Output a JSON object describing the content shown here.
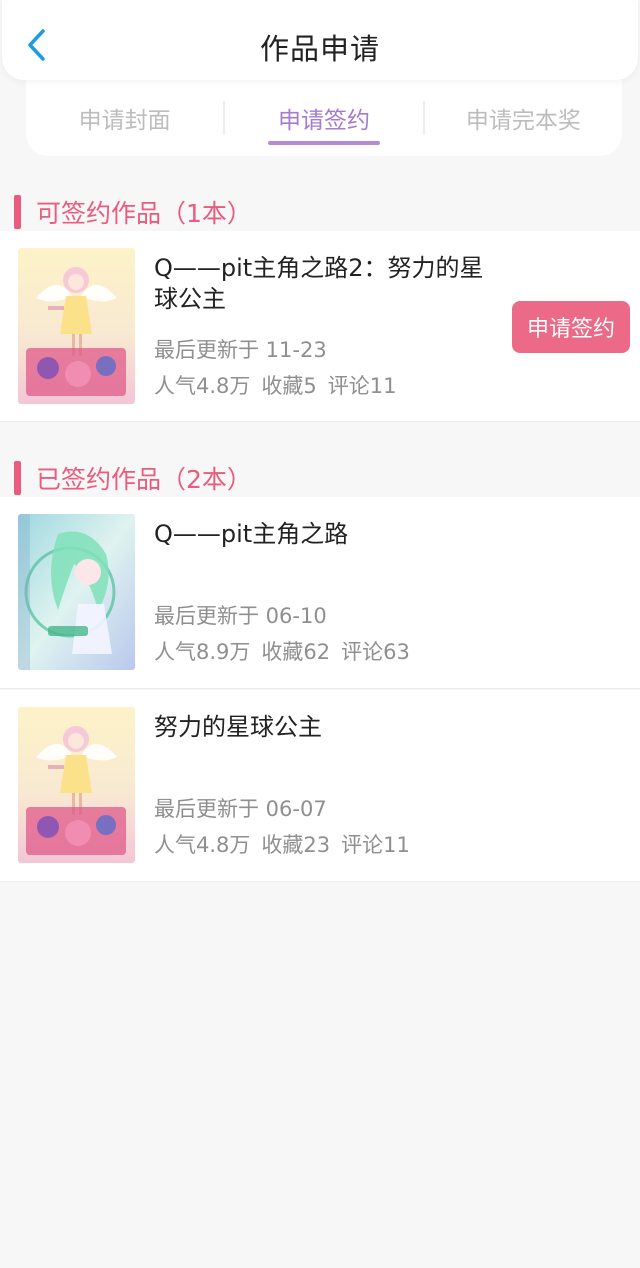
{
  "header": {
    "title": "作品申请",
    "back_icon": "chevron-left-icon"
  },
  "tabs": [
    {
      "label": "申请封面",
      "active": false
    },
    {
      "label": "申请签约",
      "active": true
    },
    {
      "label": "申请完本奖",
      "active": false
    }
  ],
  "signable": {
    "title": "可签约作品（1本）",
    "works": [
      {
        "title": "Q——pit主角之路2：努力的星球公主",
        "updated": "最后更新于 11-23",
        "popularity": "人气4.8万",
        "favorites": "收藏5",
        "comments": "评论11",
        "action_label": "申请签约"
      }
    ]
  },
  "signed": {
    "title": "已签约作品（2本）",
    "works": [
      {
        "title": "Q——pit主角之路",
        "updated": "最后更新于 06-10",
        "popularity": "人气8.9万",
        "favorites": "收藏62",
        "comments": "评论63"
      },
      {
        "title": "努力的星球公主",
        "updated": "最后更新于 06-07",
        "popularity": "人气4.8万",
        "favorites": "收藏23",
        "comments": "评论11"
      }
    ]
  },
  "colors": {
    "accent_pink": "#e95c7e",
    "tab_active": "#a57bd1",
    "button_bg": "#ec6a88"
  }
}
